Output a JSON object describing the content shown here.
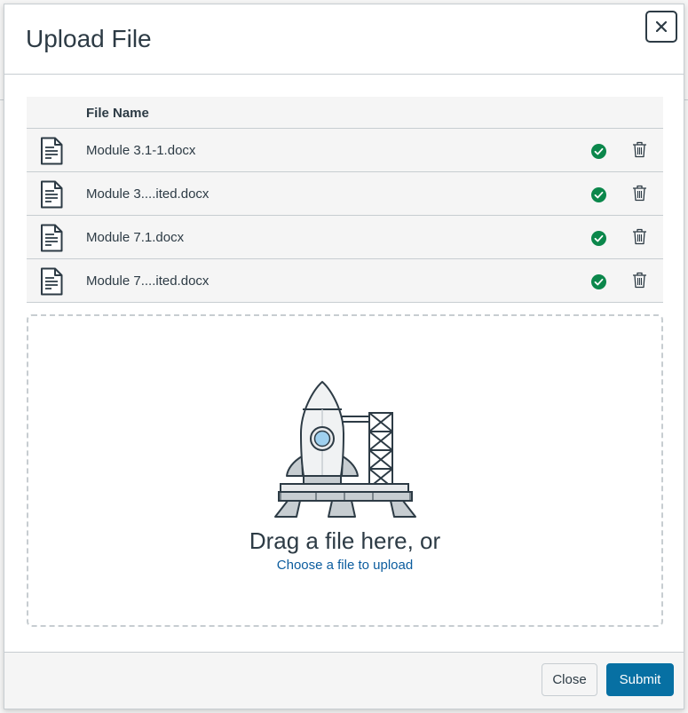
{
  "dialog": {
    "title": "Upload File",
    "close_icon": "close-icon"
  },
  "table": {
    "column_header": "File Name",
    "rows": [
      {
        "name": "Module 3.1-1.docx",
        "status": "uploaded"
      },
      {
        "name": "Module 3....ited.docx",
        "status": "uploaded"
      },
      {
        "name": "Module 7.1.docx",
        "status": "uploaded"
      },
      {
        "name": "Module 7....ited.docx",
        "status": "uploaded"
      }
    ]
  },
  "dropzone": {
    "heading": "Drag a file here, or",
    "link": "Choose a file to upload",
    "illustration": "rocket-launchpad"
  },
  "footer": {
    "close_label": "Close",
    "submit_label": "Submit"
  },
  "colors": {
    "accent": "#0770a3",
    "link": "#0b5c9e",
    "success": "#0b874b",
    "text": "#2d3b45",
    "border": "#c7cdd1"
  }
}
